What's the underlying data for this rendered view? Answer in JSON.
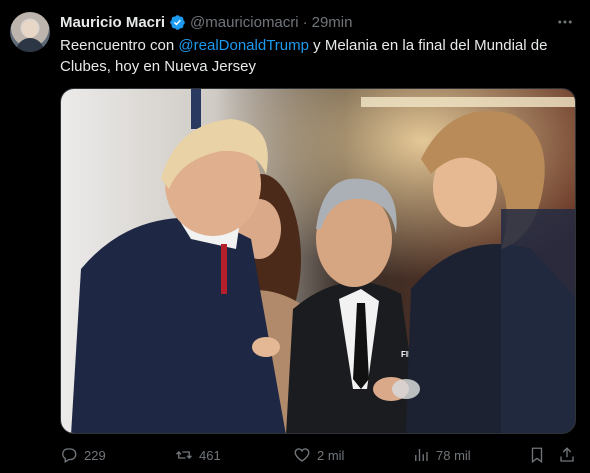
{
  "author": {
    "name": "Mauricio Macri",
    "handle": "@mauriciomacri",
    "separator": "·",
    "time": "29min"
  },
  "tweet": {
    "text_before": "Reencuentro con ",
    "mention": "@realDonaldTrump",
    "text_after": " y Melania en la final del Mundial de Clubes, hoy en Nueva Jersey"
  },
  "media": {
    "badge_text": "FIFA"
  },
  "actions": {
    "replies": "229",
    "reposts": "461",
    "likes": "2 mil",
    "views": "78 mil"
  },
  "icons": [
    "verified-badge-icon",
    "more-icon",
    "reply-icon",
    "repost-icon",
    "like-icon",
    "views-icon",
    "bookmark-icon",
    "share-icon"
  ],
  "colors": {
    "background": "#000000",
    "accent": "#1d9bf0",
    "muted": "#71767b",
    "text": "#e7e9ea"
  }
}
